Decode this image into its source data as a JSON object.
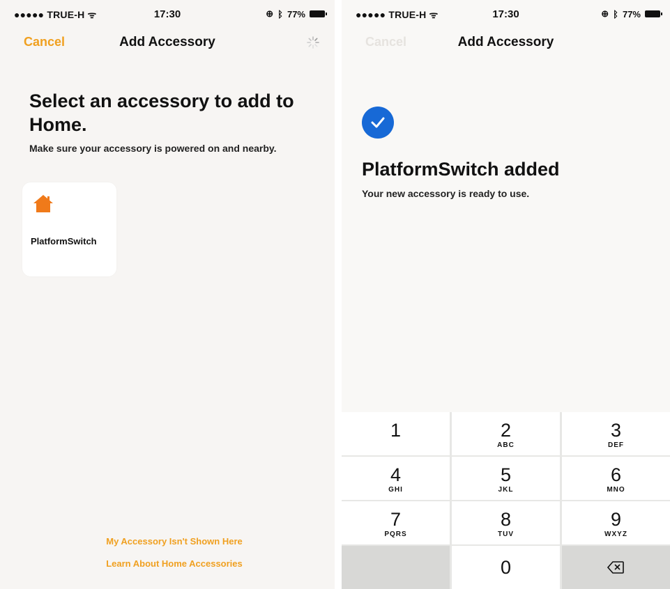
{
  "left": {
    "status": {
      "carrier": "●●●●● TRUE-H ᯤ",
      "time": "17:30",
      "battery": "77%"
    },
    "nav": {
      "cancel": "Cancel",
      "title": "Add Accessory",
      "spinner_icon": "loading-spinner-icon"
    },
    "title": "Select an accessory to add to Home.",
    "subtitle": "Make sure your accessory is powered on and nearby.",
    "accessory": {
      "name": "PlatformSwitch",
      "icon": "house-icon",
      "icon_color": "#f07a1a"
    },
    "links": {
      "not_shown": "My Accessory Isn't Shown Here",
      "learn": "Learn About Home Accessories"
    },
    "accent_color": "#f0a020"
  },
  "right": {
    "status": {
      "carrier": "●●●●● TRUE-H ᯤ",
      "time": "17:30",
      "battery": "77%"
    },
    "nav": {
      "cancel": "Cancel",
      "title": "Add Accessory"
    },
    "check_color": "#1769d6",
    "title": "PlatformSwitch added",
    "subtitle": "Your new accessory is ready to use.",
    "keypad": {
      "keys": [
        {
          "num": "1",
          "letters": ""
        },
        {
          "num": "2",
          "letters": "ABC"
        },
        {
          "num": "3",
          "letters": "DEF"
        },
        {
          "num": "4",
          "letters": "GHI"
        },
        {
          "num": "5",
          "letters": "JKL"
        },
        {
          "num": "6",
          "letters": "MNO"
        },
        {
          "num": "7",
          "letters": "PQRS"
        },
        {
          "num": "8",
          "letters": "TUV"
        },
        {
          "num": "9",
          "letters": "WXYZ"
        },
        {
          "num": "",
          "letters": ""
        },
        {
          "num": "0",
          "letters": ""
        },
        {
          "num": "",
          "letters": "",
          "icon": "backspace-icon"
        }
      ]
    }
  }
}
